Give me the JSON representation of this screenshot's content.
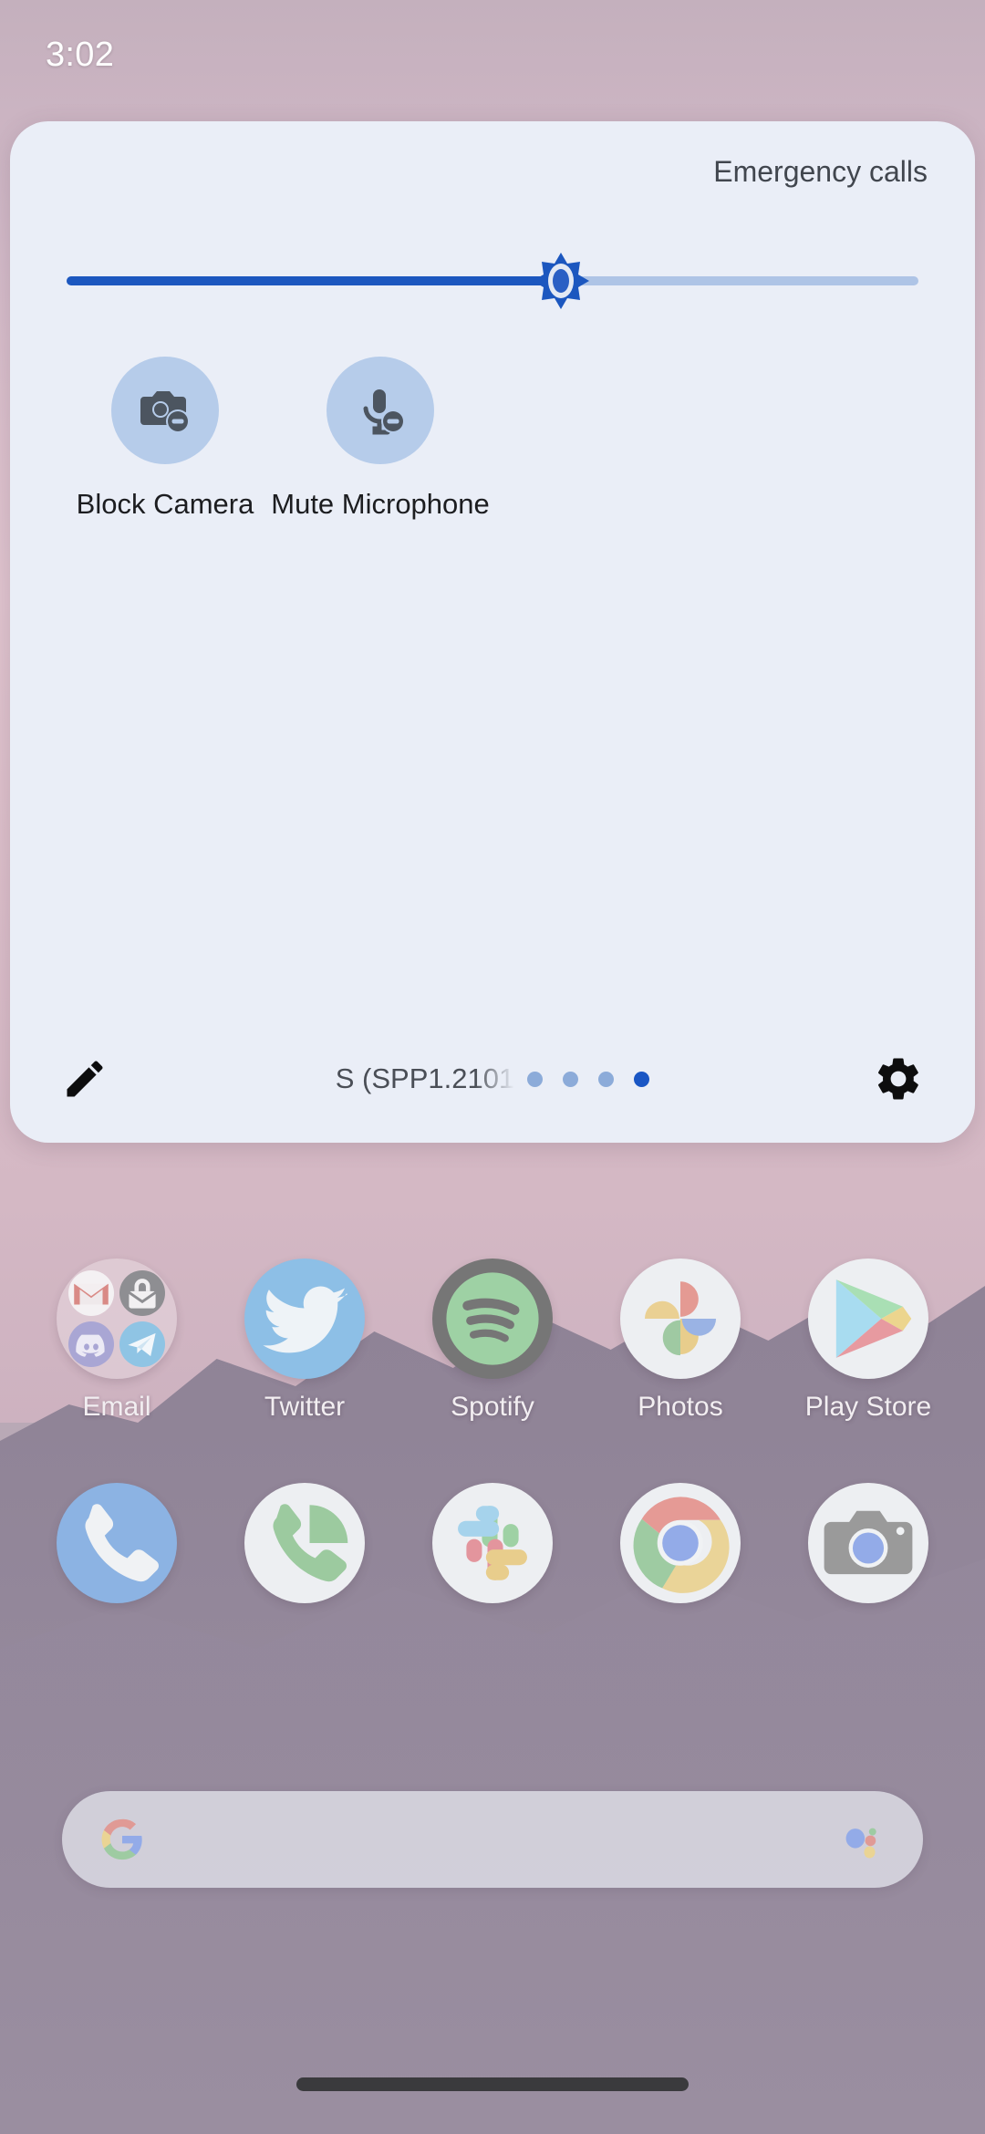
{
  "status_bar": {
    "clock": "3:02"
  },
  "quick_settings": {
    "header_text": "Emergency calls",
    "brightness": {
      "name": "brightness-slider",
      "value_percent": 58,
      "fill_color": "#1c57bf",
      "track_color": "#aec4e6"
    },
    "tiles": [
      {
        "label": "Block Camera",
        "icon": "camera-block-icon",
        "state": "on"
      },
      {
        "label": "Mute Microphone",
        "icon": "microphone-mute-icon",
        "state": "on"
      }
    ],
    "footer": {
      "edit_icon": "pencil-icon",
      "build_text": "S (SPP1.2101",
      "page_dots": {
        "count": 4,
        "active_index": 3
      },
      "settings_icon": "gear-icon"
    },
    "panel_color": "#eaeef7",
    "tile_circle_color": "#b6ccea"
  },
  "home_screen": {
    "apps": [
      {
        "label": "Email",
        "icon": "email-folder-icon"
      },
      {
        "label": "Twitter",
        "icon": "twitter-icon"
      },
      {
        "label": "Spotify",
        "icon": "spotify-icon"
      },
      {
        "label": "Photos",
        "icon": "google-photos-icon"
      },
      {
        "label": "Play Store",
        "icon": "play-store-icon"
      }
    ],
    "dock": [
      {
        "label": "Phone",
        "icon": "phone-icon"
      },
      {
        "label": "Dialer",
        "icon": "dialer-icon"
      },
      {
        "label": "Slack",
        "icon": "slack-icon"
      },
      {
        "label": "Chrome",
        "icon": "chrome-icon"
      },
      {
        "label": "Camera",
        "icon": "camera-icon"
      }
    ],
    "search_bar": {
      "logo_icon": "google-g-icon",
      "assistant_icon": "google-assistant-icon",
      "value": "",
      "placeholder": ""
    }
  },
  "navigation": {
    "pill": "gesture-home-pill"
  }
}
